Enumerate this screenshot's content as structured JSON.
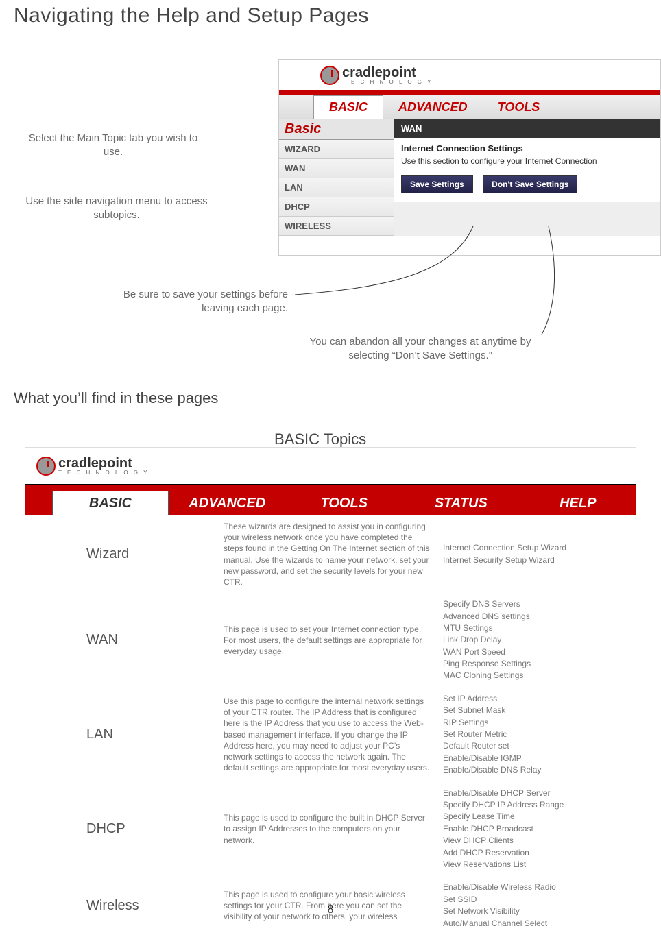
{
  "page_title": "Navigating the Help and Setup Pages",
  "callouts": {
    "c1": "Select the Main Topic tab you wish to use.",
    "c2": "Use the side navigation menu to access subtopics.",
    "c3": "Be sure to save your settings before leaving each page.",
    "c4": "You can abandon all your changes at anytime by selecting “Don’t Save Settings.”"
  },
  "logo": {
    "brand": "cradlepoint",
    "tag": "T E C H N O L O G Y"
  },
  "shot": {
    "tabs": {
      "basic": "BASIC",
      "advanced": "ADVANCED",
      "tools": "TOOLS"
    },
    "side_title": "Basic",
    "side_items": [
      "WIZARD",
      "WAN",
      "LAN",
      "DHCP",
      "WIRELESS"
    ],
    "wan": "WAN",
    "ics": "Internet Connection Settings",
    "desc": "Use this section to configure your Internet Connection",
    "save": "Save Settings",
    "dont": "Don't Save Settings"
  },
  "subheading": "What you’ll find in these pages",
  "basic_topics_title": "BASIC Topics",
  "tabs2": {
    "basic": "BASIC",
    "advanced": "ADVANCED",
    "tools": "TOOLS",
    "status": "STATUS",
    "help": "HELP"
  },
  "topics": [
    {
      "name": "Wizard",
      "desc": "These wizards are designed to assist you in configuring your wireless network once you have completed the steps found in the Getting On The Internet section of this manual.  Use the wizards to name your network, set your new password, and set the security levels for your new CTR.",
      "details": [
        "Internet Connection Setup Wizard",
        "Internet Security Setup Wizard"
      ]
    },
    {
      "name": "WAN",
      "desc": "This page is used to set your Internet connection type. For most users, the default settings are appropriate for everyday usage.",
      "details": [
        "Specify DNS Servers",
        "Advanced DNS settings",
        "MTU Settings",
        "Link Drop Delay",
        "WAN Port Speed",
        "Ping Response Settings",
        "MAC Cloning Settings"
      ]
    },
    {
      "name": "LAN",
      "desc": "Use this page to configure the internal network settings of your CTR router. The IP Address that is configured here is the IP Address that you use to access the Web-based management interface.  If you change the IP Address here, you may need to adjust your PC’s network settings to access the network again.  The default settings are appropriate for most everyday users.",
      "details": [
        "Set IP Address",
        "Set Subnet Mask",
        "RIP Settings",
        "Set Router Metric",
        "Default Router set",
        "Enable/Disable IGMP",
        "Enable/Disable DNS Relay"
      ]
    },
    {
      "name": "DHCP",
      "desc": "This page is used to configure the built in DHCP Server to assign IP Addresses to the computers on your network.",
      "details": [
        "Enable/Disable DHCP Server",
        "Specify DHCP IP Address Range",
        "Specify Lease Time",
        "Enable DHCP Broadcast",
        "View DHCP Clients",
        "Add DHCP Reservation",
        "View Reservations List"
      ]
    },
    {
      "name": "Wireless",
      "desc": "This page is used to configure your basic wireless settings for your CTR.  From here you can set the visibility of your network to others, your wireless",
      "details": [
        "Enable/Disable Wireless Radio",
        "Set SSID",
        "Set Network Visibility",
        "Auto/Manual Channel Select"
      ]
    }
  ],
  "page_number": "8"
}
